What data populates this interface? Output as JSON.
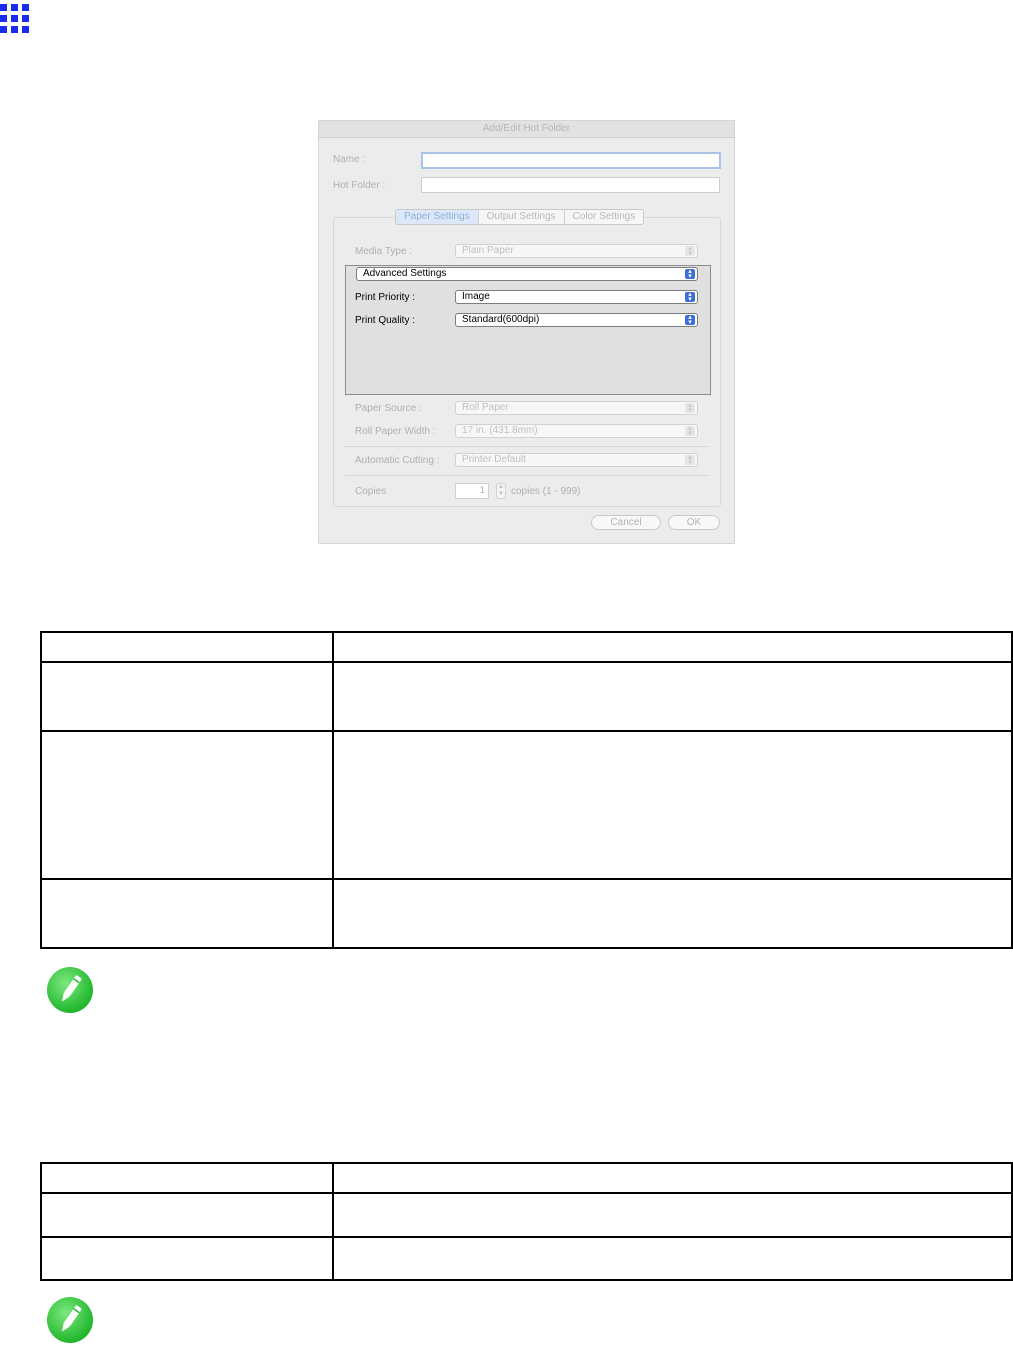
{
  "dialog": {
    "title": "Add/Edit Hot Folder",
    "name_label": "Name :",
    "name_value": "",
    "hot_folder_label": "Hot Folder :",
    "hot_folder_value": "",
    "tabs": [
      {
        "label": "Paper Settings",
        "active": true
      },
      {
        "label": "Output Settings",
        "active": false
      },
      {
        "label": "Color Settings",
        "active": false
      }
    ],
    "media_type_label": "Media Type :",
    "media_type_value": "Plain Paper",
    "advanced_settings_value": "Advanced Settings",
    "print_priority_label": "Print Priority :",
    "print_priority_value": "Image",
    "print_quality_label": "Print Quality :",
    "print_quality_value": "Standard(600dpi)",
    "paper_source_label": "Paper Source :",
    "paper_source_value": "Roll Paper",
    "roll_width_label": "Roll Paper Width :",
    "roll_width_value": "17 in. (431.8mm)",
    "auto_cut_label": "Automatic Cutting :",
    "auto_cut_value": "Printer Default",
    "copies_label": "Copies",
    "copies_value": "1",
    "copies_range": "copies (1 - 999)",
    "cancel_label": "Cancel",
    "ok_label": "OK"
  },
  "colors": {
    "grid_icon": "#1a2cf0",
    "note_icon": "#2fc83a",
    "popup_arrow": "#3d6fd8"
  },
  "icons": [
    "grid-menu-icon",
    "pencil-note-icon"
  ]
}
